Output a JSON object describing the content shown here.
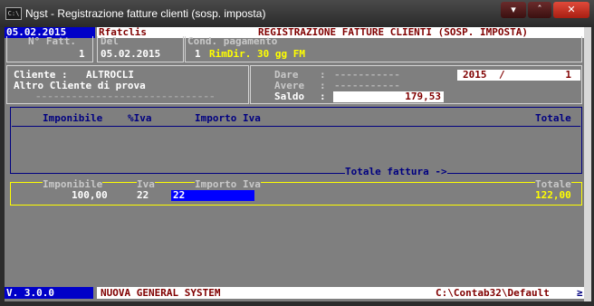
{
  "window": {
    "title": "Ngst - Registrazione fatture clienti (sosp. imposta)",
    "icon_label": "C:\\",
    "buttons": {
      "minimize": "▾",
      "maximize": "ˆ",
      "close": "✕"
    }
  },
  "header": {
    "date": "05.02.2015",
    "program": "Rfatclis",
    "screen_title": "REGISTRAZIONE FATTURE CLIENTI (SOSP. IMPOSTA)"
  },
  "invoice": {
    "number_label": "N° Fatt.",
    "number_value": "1",
    "date_label": "Del",
    "date_value": "05.02.2015",
    "payment_label": "Cond. pagamento",
    "payment_code": "1",
    "payment_desc": "RimDir. 30 gg FM"
  },
  "customer": {
    "label": "Cliente :",
    "code": "ALTROCLI",
    "name": "Altro Cliente di prova",
    "dots": "------------------------------"
  },
  "accounts": {
    "dare_label": "Dare",
    "avere_label": "Avere",
    "saldo_label": "Saldo",
    "colon": ":",
    "dare_dots": "-----------",
    "avere_dots": "-----------",
    "saldo_value": "179,53",
    "year": "2015",
    "slash": "/",
    "sequence": "1"
  },
  "table": {
    "headers": {
      "imponibile": "Imponibile",
      "iva": "%Iva",
      "importo_iva": "Importo Iva",
      "totale": "Totale"
    },
    "total_row_label": "Totale fattura ->"
  },
  "entry": {
    "labels": {
      "imponibile": "Imponibile",
      "iva": "Iva",
      "importo_iva": "Importo Iva",
      "totale": "Totale"
    },
    "imponibile": "100,00",
    "iva": "22",
    "importo_iva": "22",
    "totale": "122,00"
  },
  "status": {
    "version": "V. 3.0.0",
    "system_name": "NUOVA GENERAL SYSTEM",
    "path": "C:\\Contab32\\Default",
    "indicator": "≥"
  },
  "colors": {
    "header_blue": "#0000c8",
    "dark_red": "#800000",
    "console_gray": "#7f7f7f",
    "yellow": "#ffff00",
    "navy": "#000080"
  }
}
